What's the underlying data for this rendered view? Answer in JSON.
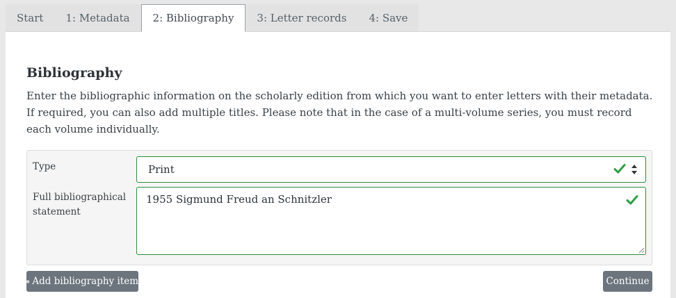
{
  "tabs": [
    {
      "label": "Start"
    },
    {
      "label": "1: Metadata"
    },
    {
      "label": "2: Bibliography"
    },
    {
      "label": "3: Letter records"
    },
    {
      "label": "4: Save"
    }
  ],
  "active_tab": "2: Bibliography",
  "section": {
    "title": "Bibliography",
    "description": "Enter the bibliographic information on the scholarly edition from which you want to enter letters with their metadata. If required, you can also add multiple titles. Please note that in the case of a multi-volume series, you must record each volume individually."
  },
  "form": {
    "type_label": "Type",
    "type_value": "Print",
    "full_label": "Full bibliographical statement",
    "full_value": "1955 Sigmund Freud an Schnitzler",
    "valid_color": "#2e9e44"
  },
  "buttons": {
    "add_label": "Add bibliography item",
    "continue_label": "Continue"
  },
  "icons": {
    "valid": "check-icon",
    "select_arrows": "sort-arrows-icon",
    "add": "plus-circle-icon",
    "resize": "resize-grip-icon"
  }
}
